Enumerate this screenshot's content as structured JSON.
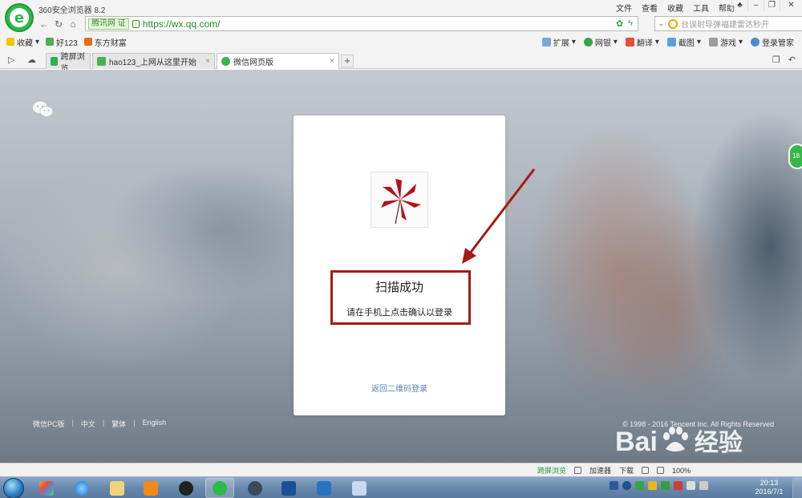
{
  "window": {
    "title": "360安全浏览器 8.2",
    "menu": [
      "文件",
      "查看",
      "收藏",
      "工具",
      "帮助"
    ]
  },
  "nav": {
    "site_badge": "腾讯网",
    "site_badge_cert": "证",
    "url": "https://wx.qq.com/",
    "search_placeholder": "台误射导弹福建雷达秒开"
  },
  "favorites": {
    "items": [
      "收藏",
      "好123",
      "东方财富"
    ],
    "tools": [
      "扩展",
      "网银",
      "翻译",
      "截图",
      "游戏",
      "登录管家"
    ]
  },
  "tabs": [
    {
      "label": "跨屏浏览",
      "active": false
    },
    {
      "label": "hao123_上网从这里开始",
      "active": false
    },
    {
      "label": "微信网页版",
      "active": true
    }
  ],
  "login": {
    "title": "扫描成功",
    "subtitle": "请在手机上点击确认以登录",
    "return_link": "返回二维码登录"
  },
  "footer": {
    "links": [
      "微信PC版",
      "中文",
      "繁体",
      "English"
    ],
    "copyright": "© 1998 - 2016 Tencent Inc. All Rights Reserved"
  },
  "side_badge": "18",
  "watermark": {
    "part1": "Bai",
    "part2": "经验"
  },
  "statusbar": {
    "items": [
      "跨屏浏览",
      "加速器",
      "下载",
      "100%"
    ]
  },
  "clock": {
    "time": "20:13",
    "date": "2016/7/1"
  },
  "colors": {
    "accent_green": "#2db84a",
    "highlight_red": "#a61a14",
    "link_blue": "#5b7fa6"
  }
}
